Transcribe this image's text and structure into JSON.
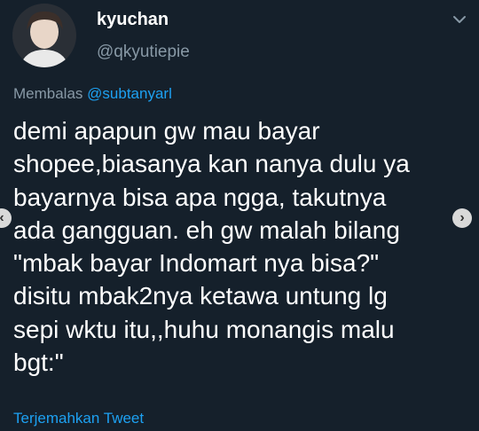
{
  "tweet": {
    "display_name": "kyuchan",
    "handle": "@qkyutiepie",
    "reply_prefix": "Membalas",
    "reply_mention": "@subtanyarl",
    "lines": [
      "demi apapun gw mau bayar",
      "shopee,biasanya kan nanya dulu ya",
      "bayarnya bisa apa ngga, takutnya",
      "ada gangguan. eh gw malah bilang",
      "\"mbak bayar Indomart nya bisa?\"",
      "disitu mbak2nya ketawa untung lg",
      "sepi wktu itu,,huhu monangis malu",
      "bgt:\""
    ],
    "translate_label": "Terjemahkan Tweet"
  },
  "icons": {
    "menu": "chevron-down-icon",
    "prev": "chevron-left-icon",
    "next": "chevron-right-icon"
  },
  "colors": {
    "background": "#15202b",
    "text": "#ffffff",
    "secondary": "#8899a6",
    "link": "#1da1f2"
  }
}
